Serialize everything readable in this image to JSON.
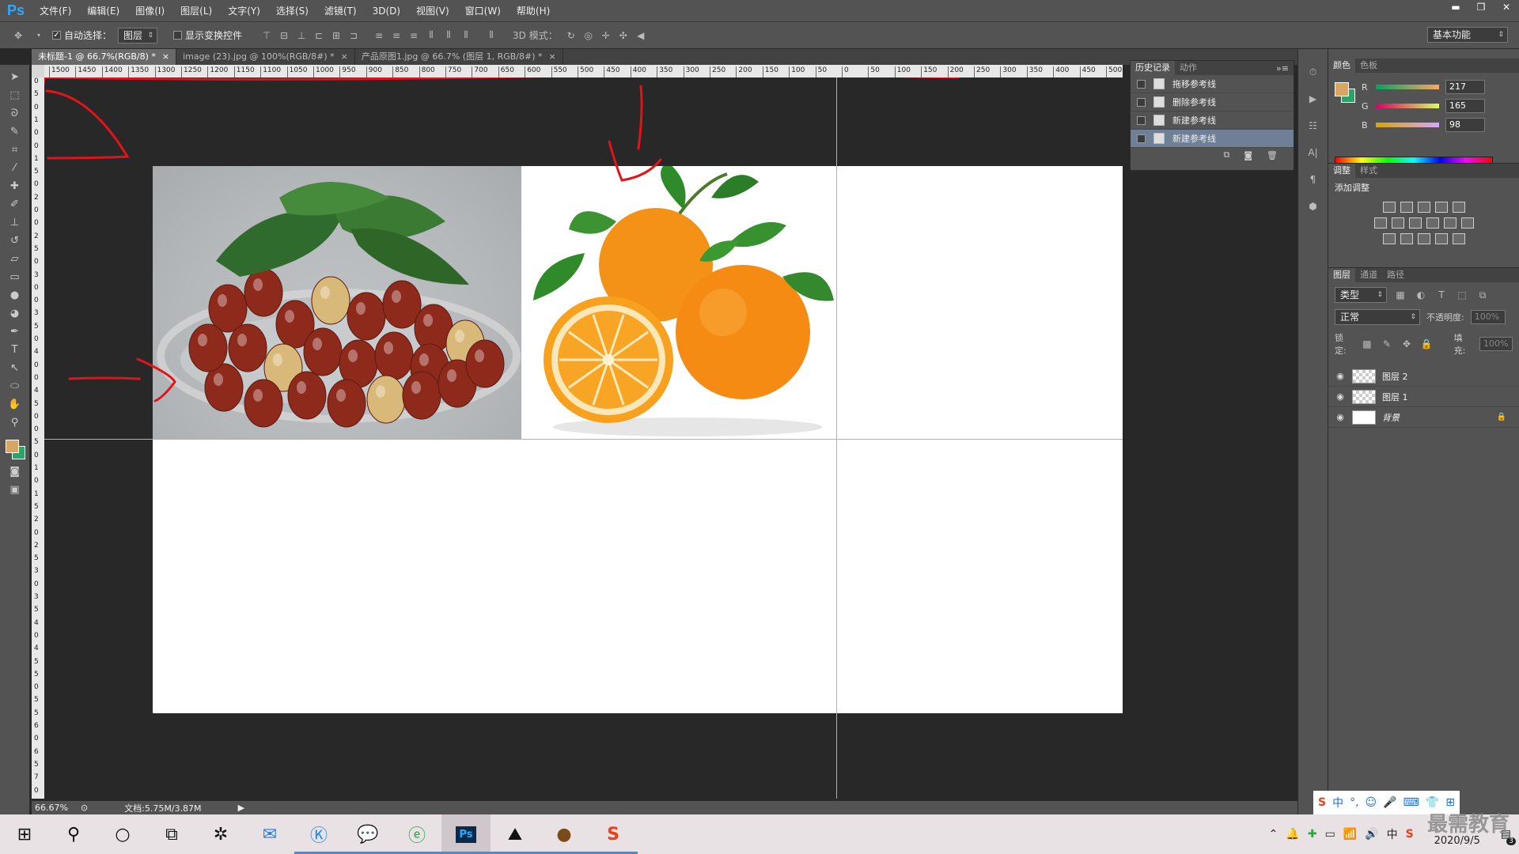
{
  "app": {
    "logo": "Ps"
  },
  "menu": [
    "文件(F)",
    "编辑(E)",
    "图像(I)",
    "图层(L)",
    "文字(Y)",
    "选择(S)",
    "滤镜(T)",
    "3D(D)",
    "视图(V)",
    "窗口(W)",
    "帮助(H)"
  ],
  "window_controls": {
    "minimize": "▬",
    "restore": "❐",
    "close": "✕"
  },
  "options": {
    "auto_select_label": "自动选择：",
    "auto_select_value": "图层",
    "show_transform_label": "显示变换控件",
    "mode3d_label": "3D 模式：",
    "workspace": "基本功能"
  },
  "tabs": [
    {
      "label": "未标题-1 @ 66.7%(RGB/8) *",
      "close": "×"
    },
    {
      "label": "image (23).jpg @ 100%(RGB/8#) *",
      "close": "×"
    },
    {
      "label": "产品原图1.jpg @ 66.7% (图层 1, RGB/8#) *",
      "close": "×"
    }
  ],
  "ruler_h": [
    "1500",
    "1450",
    "1400",
    "1350",
    "1300",
    "1250",
    "1200",
    "1150",
    "1100",
    "1050",
    "1000",
    "950",
    "900",
    "850",
    "800",
    "750",
    "700",
    "650",
    "600",
    "550",
    "500",
    "450",
    "400",
    "350",
    "300",
    "250",
    "200",
    "150",
    "100",
    "50",
    "0",
    "50",
    "100",
    "150",
    "200",
    "250",
    "300",
    "350",
    "400",
    "450",
    "500"
  ],
  "ruler_v": [
    "0",
    "5",
    "0",
    "1",
    "0",
    "0",
    "1",
    "5",
    "0",
    "2",
    "0",
    "0",
    "2",
    "5",
    "0",
    "3",
    "0",
    "0",
    "3",
    "5",
    "0",
    "4",
    "0",
    "0",
    "4",
    "5",
    "0",
    "0",
    "5",
    "0",
    "1",
    "0",
    "1",
    "5",
    "2",
    "0",
    "2",
    "5",
    "3",
    "0",
    "3",
    "5",
    "4",
    "0",
    "4",
    "5",
    "5",
    "0",
    "5",
    "5",
    "6",
    "0",
    "6",
    "5",
    "7",
    "0"
  ],
  "history": {
    "tabs": [
      "历史记录",
      "动作"
    ],
    "items": [
      "拖移参考线",
      "删除参考线",
      "新建参考线",
      "新建参考线"
    ],
    "selected_index": 3
  },
  "color_panel": {
    "tabs": [
      "颜色",
      "色板"
    ],
    "r_label": "R",
    "g_label": "G",
    "b_label": "B",
    "r": "217",
    "g": "165",
    "b": "98",
    "foreground": "#d9a562",
    "background": "#2aa56a"
  },
  "adjust_panel": {
    "tabs": [
      "调整",
      "样式"
    ],
    "title": "添加调整"
  },
  "layers_panel": {
    "tabs": [
      "图层",
      "通道",
      "路径"
    ],
    "filter": "类型",
    "blend": "正常",
    "opacity_label": "不透明度:",
    "opacity": "100%",
    "lock_label": "锁定:",
    "fill_label": "填充:",
    "fill": "100%",
    "layers": [
      {
        "name": "图层 2"
      },
      {
        "name": "图层 1"
      },
      {
        "name": "背景"
      }
    ]
  },
  "status": {
    "zoom": "66.67%",
    "doc": "文档:5.75M/3.87M"
  },
  "taskbar": {
    "clock_date": "2020/9/5",
    "notif_count": "3"
  },
  "ime": {
    "mode": "中"
  },
  "watermark": "最需教育"
}
